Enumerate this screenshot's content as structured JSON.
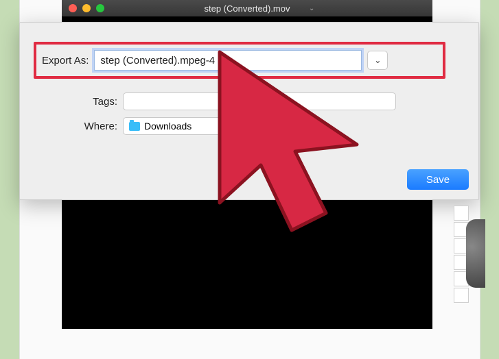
{
  "titlebar": {
    "title": "step (Converted).mov"
  },
  "dialog": {
    "export_label": "Export As:",
    "export_value": "step (Converted).mpeg-4",
    "tags_label": "Tags:",
    "tags_value": "",
    "where_label": "Where:",
    "where_value": "Downloads",
    "save_label": "Save"
  }
}
